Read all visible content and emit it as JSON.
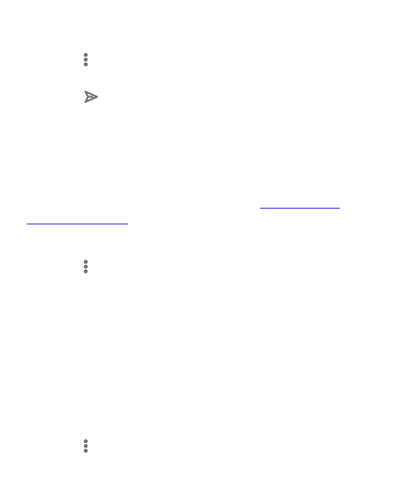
{
  "icons": {
    "menu_icon": "more-vertical-icon",
    "send_icon": "send-icon",
    "icon_color": "#6f6f6f"
  },
  "link": {
    "color": "#2020c8"
  }
}
